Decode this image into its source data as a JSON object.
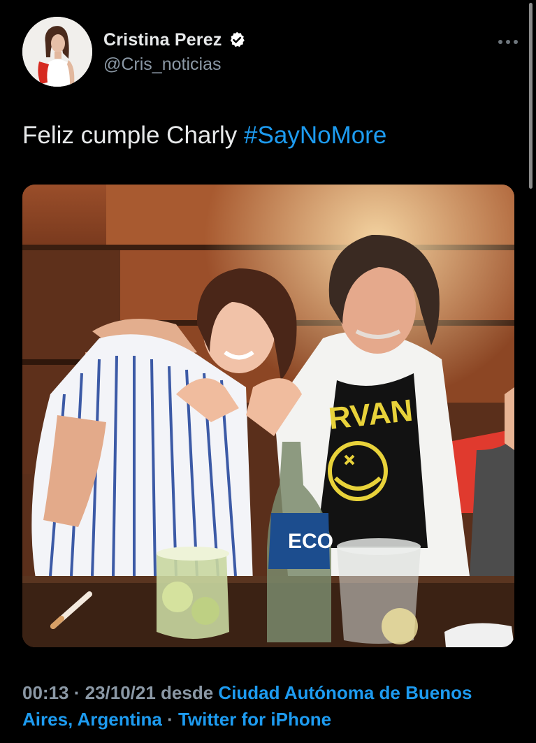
{
  "tweet": {
    "author": {
      "display_name": "Cristina Perez",
      "handle": "@Cris_noticias",
      "verified": true
    },
    "text": "Feliz cumple Charly ",
    "hashtag": "#SayNoMore",
    "photo_print": {
      "shirt_text": "RVAN",
      "bottle_label": "ECO"
    },
    "meta": {
      "time": "00:13",
      "separator1": " · ",
      "date": "23/10/21",
      "from_word": " desde ",
      "location": "Ciudad Autónoma de Buenos Aires, Argentina",
      "separator2": " · ",
      "source": "Twitter for iPhone"
    }
  },
  "colors": {
    "background": "#000000",
    "text": "#e7e9ea",
    "secondary": "#8b98a5",
    "link": "#1d9bf0"
  },
  "icons": [
    "verified-badge-icon",
    "more-options-icon"
  ]
}
